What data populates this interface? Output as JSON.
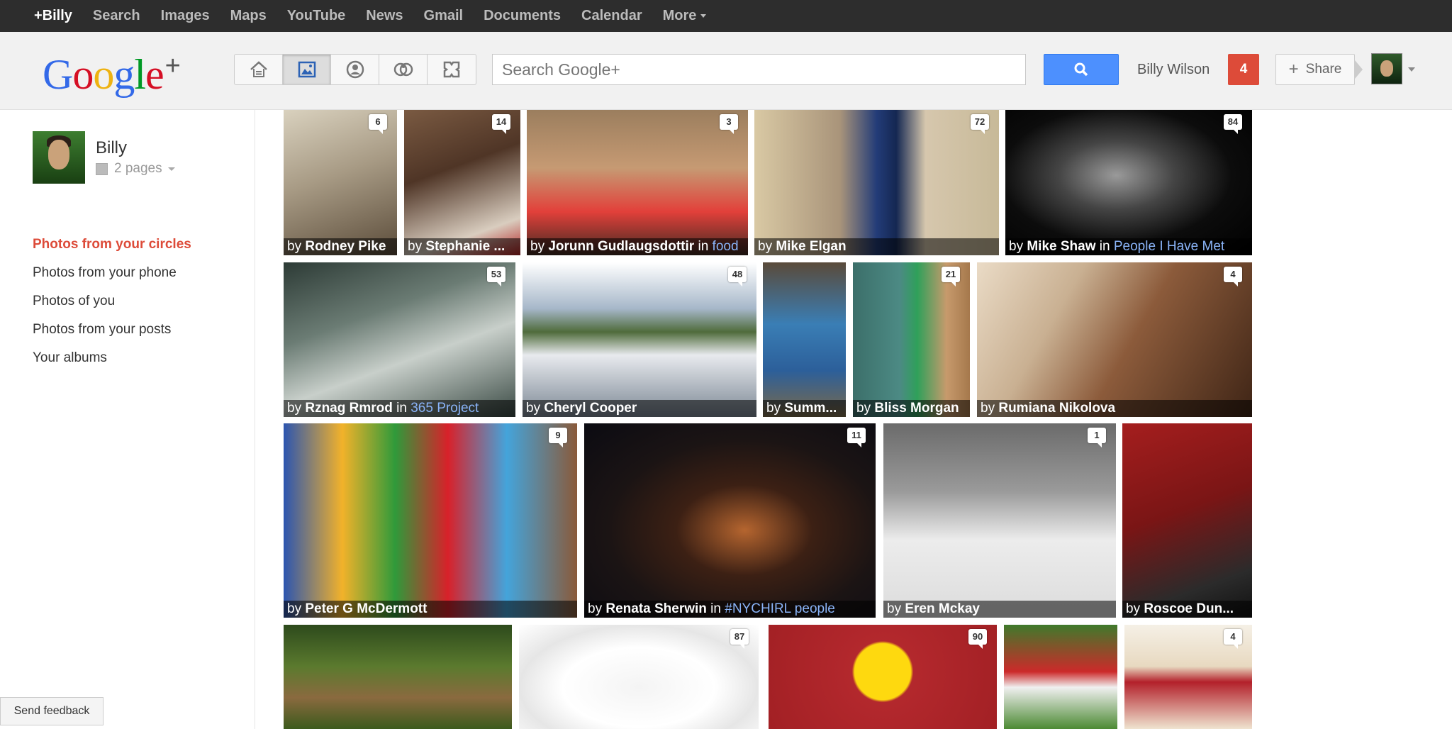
{
  "topbar": {
    "items": [
      "+Billy",
      "Search",
      "Images",
      "Maps",
      "YouTube",
      "News",
      "Gmail",
      "Documents",
      "Calendar",
      "More"
    ]
  },
  "header": {
    "logo_text": "Google",
    "logo_plus": "+",
    "search_placeholder": "Search Google+",
    "user_name": "Billy Wilson",
    "notifications": "4",
    "share_label": "Share"
  },
  "sidebar": {
    "profile_name": "Billy",
    "pages": "2 pages",
    "links": [
      {
        "label": "Photos from your circles",
        "active": true
      },
      {
        "label": "Photos from your phone",
        "active": false
      },
      {
        "label": "Photos of you",
        "active": false
      },
      {
        "label": "Photos from your posts",
        "active": false
      },
      {
        "label": "Your albums",
        "active": false
      }
    ],
    "feedback": "Send feedback"
  },
  "colors": {
    "accent_red": "#dd4b39",
    "search_blue": "#4d90fe",
    "topbar_bg": "#2d2d2d",
    "circle_link": "#8ab4f8"
  },
  "photos": [
    {
      "author": "Rodney Pike",
      "circle": "",
      "count": "6",
      "bg": "linear-gradient(160deg,#d9d1be 0%,#a79a84 45%,#5b4c3a 100%)"
    },
    {
      "author": "Stephanie ...",
      "circle": "",
      "count": "14",
      "bg": "linear-gradient(160deg,#7a5a42 0%,#4f3526 40%,#d9cdbf 80%,#b42323 100%)"
    },
    {
      "author": "Jorunn Gudlaugsdottir",
      "circle": "food",
      "count": "3",
      "bg": "linear-gradient(180deg,#9b7e5e 0%,#c69a73 40%,#e2403a 70%,#402a22 100%)"
    },
    {
      "author": "Mike Elgan",
      "circle": "",
      "count": "72",
      "bg": "linear-gradient(90deg,#d9c9a4 0%,#a9947a 35%,#233c78 50%,#142752 58%,#d6c7ad 70%,#c7b998 100%)"
    },
    {
      "author": "Mike Shaw",
      "circle": "People I Have Met",
      "count": "84",
      "bg": "radial-gradient(ellipse at 45% 45%,#9a9a9a 0%,#454545 30%,#0c0c0c 60%,#000 100%)"
    },
    {
      "author": "Rznag Rmrod",
      "circle": "365 Project",
      "count": "53",
      "bg": "linear-gradient(160deg,#2d3b36 0%,#6b7c74 35%,#c8cfca 60%,#3a4a44 100%)"
    },
    {
      "author": "Cheryl Cooper",
      "circle": "",
      "count": "48",
      "bg": "linear-gradient(180deg,#ffffff 0%,#a6b7c9 30%,#4f6b3b 45%,#e8eaee 60%,#7b8794 100%)"
    },
    {
      "author": "Summ...",
      "circle": "",
      "count": "",
      "bg": "linear-gradient(180deg,#5a4a3a 0%,#3a7eb5 40%,#2c5f9a 70%,#7b6a4a 100%)"
    },
    {
      "author": "Bliss Morgan",
      "circle": "",
      "count": "21",
      "bg": "linear-gradient(90deg,#3c6f6a 0%,#4c8a84 40%,#2fa05a 55%,#c79a6c 80%,#a5784c 100%)"
    },
    {
      "author": "Rumiana Nikolova",
      "circle": "",
      "count": "4",
      "bg": "linear-gradient(120deg,#eadbc6 0%,#c9b092 30%,#8c5b3b 55%,#3f2516 100%)"
    },
    {
      "author": "Peter G McDermott",
      "circle": "",
      "count": "9",
      "bg": "linear-gradient(90deg,#2c55b0 0%,#f2b22a 20%,#2f9a3a 38%,#d8212a 56%,#44a4db 76%,#8a5a3a 100%)"
    },
    {
      "author": "Renata Sherwin",
      "circle": "#NYCHIRL people",
      "count": "11",
      "bg": "radial-gradient(ellipse at 55% 55%,#b5652f 0%,#3c2014 30%,#1b1414 60%,#0b0b12 100%)"
    },
    {
      "author": "Eren Mckay",
      "circle": "",
      "count": "1",
      "bg": "linear-gradient(180deg,#6b6b6b 0%,#9a9a9a 35%,#ececec 60%,#dcdcdc 100%)"
    },
    {
      "author": "Roscoe Dun...",
      "circle": "",
      "count": "",
      "bg": "linear-gradient(160deg,#a51e1e 0%,#7a1515 45%,#2b2b2b 80%,#111 100%)"
    },
    {
      "author": "",
      "circle": "",
      "count": "",
      "bg": "linear-gradient(180deg,#2d4a1c 0%,#5b7a2e 40%,#8a6a3f 70%,#3c5a1c 100%)"
    },
    {
      "author": "",
      "circle": "",
      "count": "87",
      "bg": "radial-gradient(ellipse at 50% 60%,#f4f4f4 0%,#ffffff 45%,#e6e6e6 70%,#fff 100%)"
    },
    {
      "author": "",
      "circle": "",
      "count": "90",
      "bg": "radial-gradient(circle at 50% 45%,#fed90f 0%,#fed90f 22%,#b3282d 24%,#a22024 100%)"
    },
    {
      "author": "",
      "circle": "",
      "count": "",
      "bg": "linear-gradient(180deg,#3f7a2b 0%,#cc2a2a 45%,#f0f0f0 60%,#4c8a33 100%)"
    },
    {
      "author": "",
      "circle": "",
      "count": "4",
      "bg": "linear-gradient(180deg,#f5f0e6 0%,#e8d9c0 40%,#b3202a 55%,#efe4d0 100%)"
    }
  ]
}
